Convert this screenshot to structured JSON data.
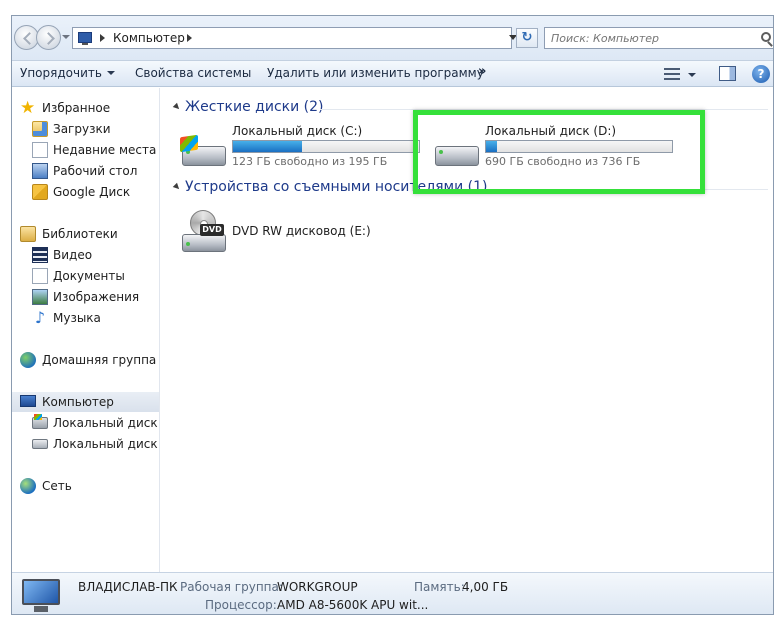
{
  "address_bar": {
    "breadcrumb": "Компьютер",
    "search_placeholder": "Поиск: Компьютер",
    "refresh_icon": "↻"
  },
  "toolbar": {
    "organize": "Упорядочить",
    "system_properties": "Свойства системы",
    "uninstall": "Удалить или изменить программу",
    "more": "»",
    "help": "?"
  },
  "sidebar": {
    "favorites": {
      "label": "Избранное",
      "items": [
        "Загрузки",
        "Недавние места",
        "Рабочий стол",
        "Google Диск"
      ]
    },
    "libraries": {
      "label": "Библиотеки",
      "items": [
        "Видео",
        "Документы",
        "Изображения",
        "Музыка"
      ]
    },
    "homegroup": "Домашняя группа",
    "computer": {
      "label": "Компьютер",
      "items": [
        "Локальный диск (C",
        "Локальный диск (D"
      ]
    },
    "network": "Сеть"
  },
  "content": {
    "hard_disks": {
      "title": "Жесткие диски (2)",
      "drives": [
        {
          "name": "Локальный диск (C:)",
          "free_text": "123 ГБ свободно из 195 ГБ",
          "used_fraction": 0.37
        },
        {
          "name": "Локальный диск (D:)",
          "free_text": "690 ГБ свободно из 736 ГБ",
          "used_fraction": 0.06
        }
      ]
    },
    "removable": {
      "title": "Устройства со съемными носителями (1)",
      "drives": [
        {
          "name": "DVD RW дисковод (E:)",
          "icon_label": "DVD"
        }
      ]
    }
  },
  "details": {
    "computer_name": "ВЛАДИСЛАВ-ПК",
    "workgroup_label": "Рабочая группа:",
    "workgroup_value": "WORKGROUP",
    "memory_label": "Память:",
    "memory_value": "4,00 ГБ",
    "cpu_label": "Процессор:",
    "cpu_value": "AMD A8-5600K APU wit..."
  },
  "colors": {
    "highlight": "#35e03a",
    "group_title": "#1e3a8a",
    "bar_fill": "#1a6fc2"
  }
}
